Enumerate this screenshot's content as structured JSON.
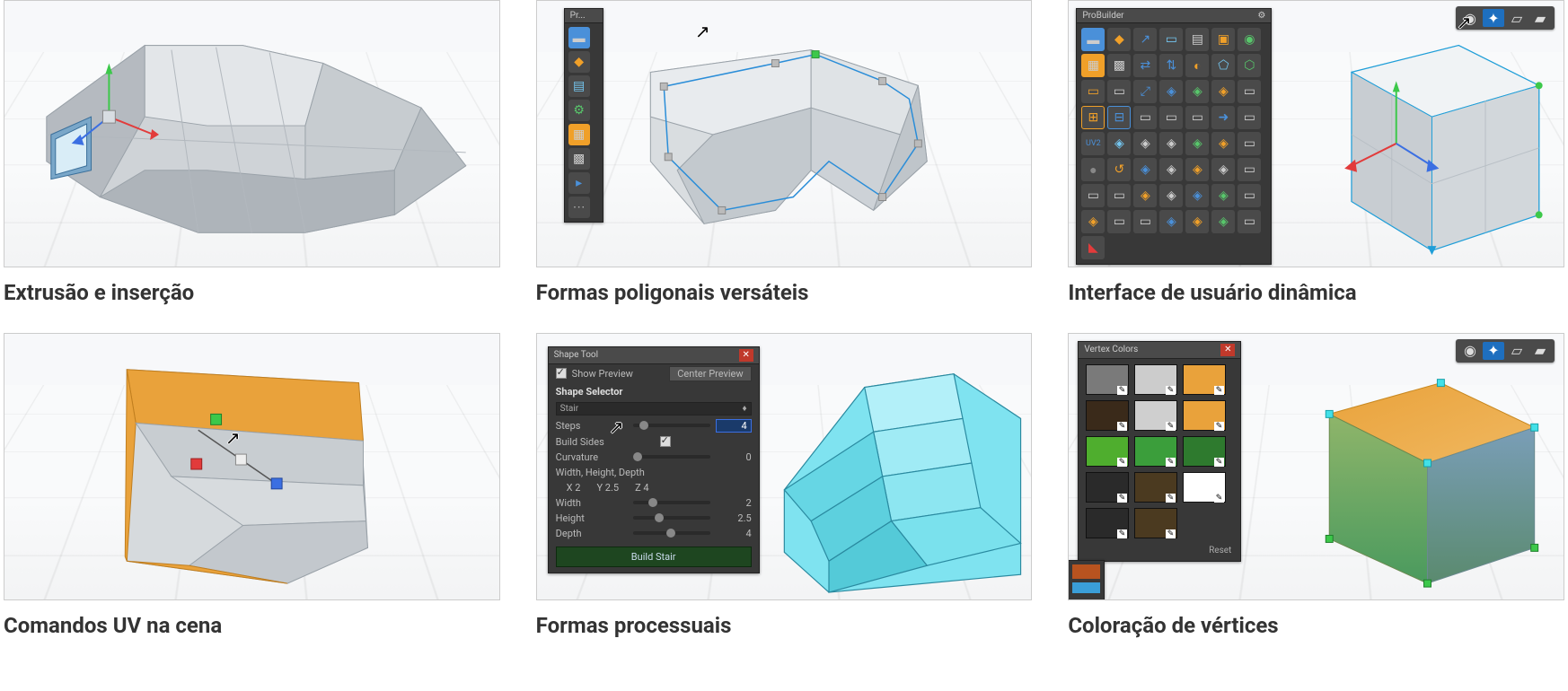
{
  "cards": [
    {
      "caption": "Extrusão e inserção"
    },
    {
      "caption": "Formas poligonais versáteis"
    },
    {
      "caption": "Interface de usuário dinâmica"
    },
    {
      "caption": "Comandos UV na cena"
    },
    {
      "caption": "Formas processuais"
    },
    {
      "caption": "Coloração de vértices"
    }
  ],
  "panel2": {
    "title": "Pr..."
  },
  "panel3": {
    "title": "ProBuilder"
  },
  "shapeTool": {
    "title": "Shape Tool",
    "showPreview": "Show Preview",
    "centerPreview": "Center Preview",
    "section": "Shape Selector",
    "shape": "Stair",
    "steps_label": "Steps",
    "steps_value": "4",
    "buildSides_label": "Build Sides",
    "curvature_label": "Curvature",
    "curvature_value": "0",
    "whd_label": "Width, Height, Depth",
    "x_label": "X 2",
    "y_label": "Y 2.5",
    "z_label": "Z 4",
    "width_label": "Width",
    "width_value": "2",
    "height_label": "Height",
    "height_value": "2.5",
    "depth_label": "Depth",
    "depth_value": "4",
    "build_btn": "Build Stair"
  },
  "vertexColors": {
    "title": "Vertex Colors",
    "reset": "Reset",
    "swatches": [
      "#7a7a7a",
      "#cccccc",
      "#e9a23b",
      "#3a2a1a",
      "#cfcfcf",
      "#e9a23b",
      "#4fae2e",
      "#3b9e3b",
      "#2e7a2e",
      "#2a2a2a",
      "#4b3a20",
      "#ffffff",
      "#2a2a2a",
      "#4b3a20"
    ]
  },
  "extraSwatch": "#b8531f"
}
